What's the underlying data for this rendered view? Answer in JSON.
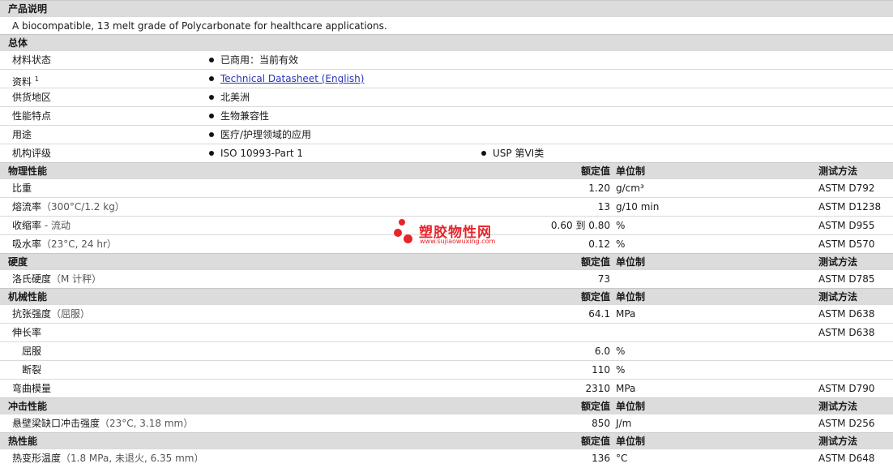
{
  "sections": {
    "product_desc": {
      "title": "产品说明",
      "text": "A biocompatible, 13 melt grade of Polycarbonate for healthcare applications."
    },
    "general": {
      "title": "总体",
      "rows": [
        {
          "label": "材料状态",
          "values": [
            "已商用：当前有效"
          ]
        },
        {
          "label": "资料",
          "sup": "1",
          "values": [
            "Technical Datasheet (English)"
          ],
          "link": true
        },
        {
          "label": "供货地区",
          "values": [
            "北美洲"
          ]
        },
        {
          "label": "性能特点",
          "values": [
            "生物兼容性"
          ]
        },
        {
          "label": "用途",
          "values": [
            "医疗/护理领域的应用"
          ]
        },
        {
          "label": "机构评级",
          "values": [
            "ISO 10993-Part 1",
            "USP 第VI类"
          ]
        }
      ]
    },
    "physical": {
      "title": "物理性能",
      "h_val": "额定值",
      "h_unit": "单位制",
      "h_test": "测试方法",
      "rows": [
        {
          "label": "比重",
          "paren": "",
          "val": "1.20",
          "unit": "g/cm³",
          "test": "ASTM D792"
        },
        {
          "label": "熔流率",
          "paren": "（300°C/1.2 kg）",
          "val": "13",
          "unit": "g/10 min",
          "test": "ASTM D1238"
        },
        {
          "label": "收缩率",
          "paren": " - 流动",
          "val": "0.60 到  0.80",
          "unit": "%",
          "test": "ASTM D955"
        },
        {
          "label": "吸水率",
          "paren": "（23°C, 24 hr）",
          "val": "0.12",
          "unit": "%",
          "test": "ASTM D570"
        }
      ]
    },
    "hardness": {
      "title": "硬度",
      "h_val": "额定值",
      "h_unit": "单位制",
      "h_test": "测试方法",
      "rows": [
        {
          "label": "洛氏硬度",
          "paren": "（M 计秤）",
          "val": "73",
          "unit": "",
          "test": "ASTM D785"
        }
      ]
    },
    "mechanical": {
      "title": "机械性能",
      "h_val": "额定值",
      "h_unit": "单位制",
      "h_test": "测试方法",
      "rows": [
        {
          "label": "抗张强度",
          "paren": "（屈服）",
          "val": "64.1",
          "unit": "MPa",
          "test": "ASTM D638"
        },
        {
          "label": "伸长率",
          "paren": "",
          "val": "",
          "unit": "",
          "test": "ASTM D638"
        },
        {
          "label": "屈服",
          "paren": "",
          "val": "6.0",
          "unit": "%",
          "test": "",
          "sub": true
        },
        {
          "label": "断裂",
          "paren": "",
          "val": "110",
          "unit": "%",
          "test": "",
          "sub": true
        },
        {
          "label": "弯曲模量",
          "paren": "",
          "val": "2310",
          "unit": "MPa",
          "test": "ASTM D790"
        }
      ]
    },
    "impact": {
      "title": "冲击性能",
      "h_val": "额定值",
      "h_unit": "单位制",
      "h_test": "测试方法",
      "rows": [
        {
          "label": "悬壁梁缺口冲击强度",
          "paren": "（23°C, 3.18 mm）",
          "val": "850",
          "unit": "J/m",
          "test": "ASTM D256"
        }
      ]
    },
    "thermal": {
      "title": "热性能",
      "h_val": "额定值",
      "h_unit": "单位制",
      "h_test": "测试方法",
      "rows": [
        {
          "label": "热变形温度",
          "paren": "（1.8 MPa, 未退火, 6.35 mm）",
          "val": "136",
          "unit": "°C",
          "test": "ASTM D648"
        }
      ]
    }
  },
  "watermark": {
    "cn": "塑胶物性网",
    "url": "www.sujiaowuxing.com",
    "color": "#e8242b"
  }
}
